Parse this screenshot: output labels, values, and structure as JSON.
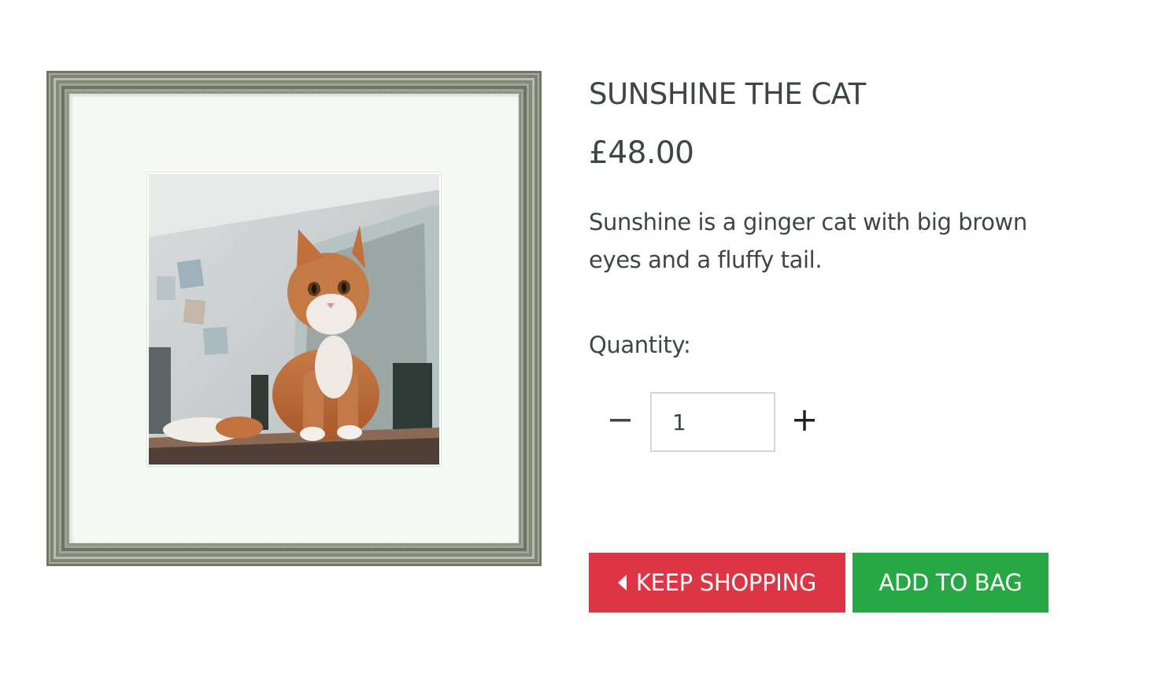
{
  "product": {
    "title": "SUNSHINE THE CAT",
    "price": "£48.00",
    "description": "Sunshine is a ginger cat with big brown eyes and a fluffy tail."
  },
  "quantity": {
    "label": "Quantity:",
    "value": "1",
    "minus_icon": "minus-icon",
    "plus_icon": "plus-icon"
  },
  "actions": {
    "keep_shopping_label": "KEEP SHOPPING",
    "keep_shopping_icon": "caret-left-icon",
    "add_to_bag_label": "ADD TO BAG"
  },
  "colors": {
    "text": "#3d4742",
    "keep_shopping_bg": "#dc3545",
    "add_to_bag_bg": "#28a745"
  }
}
